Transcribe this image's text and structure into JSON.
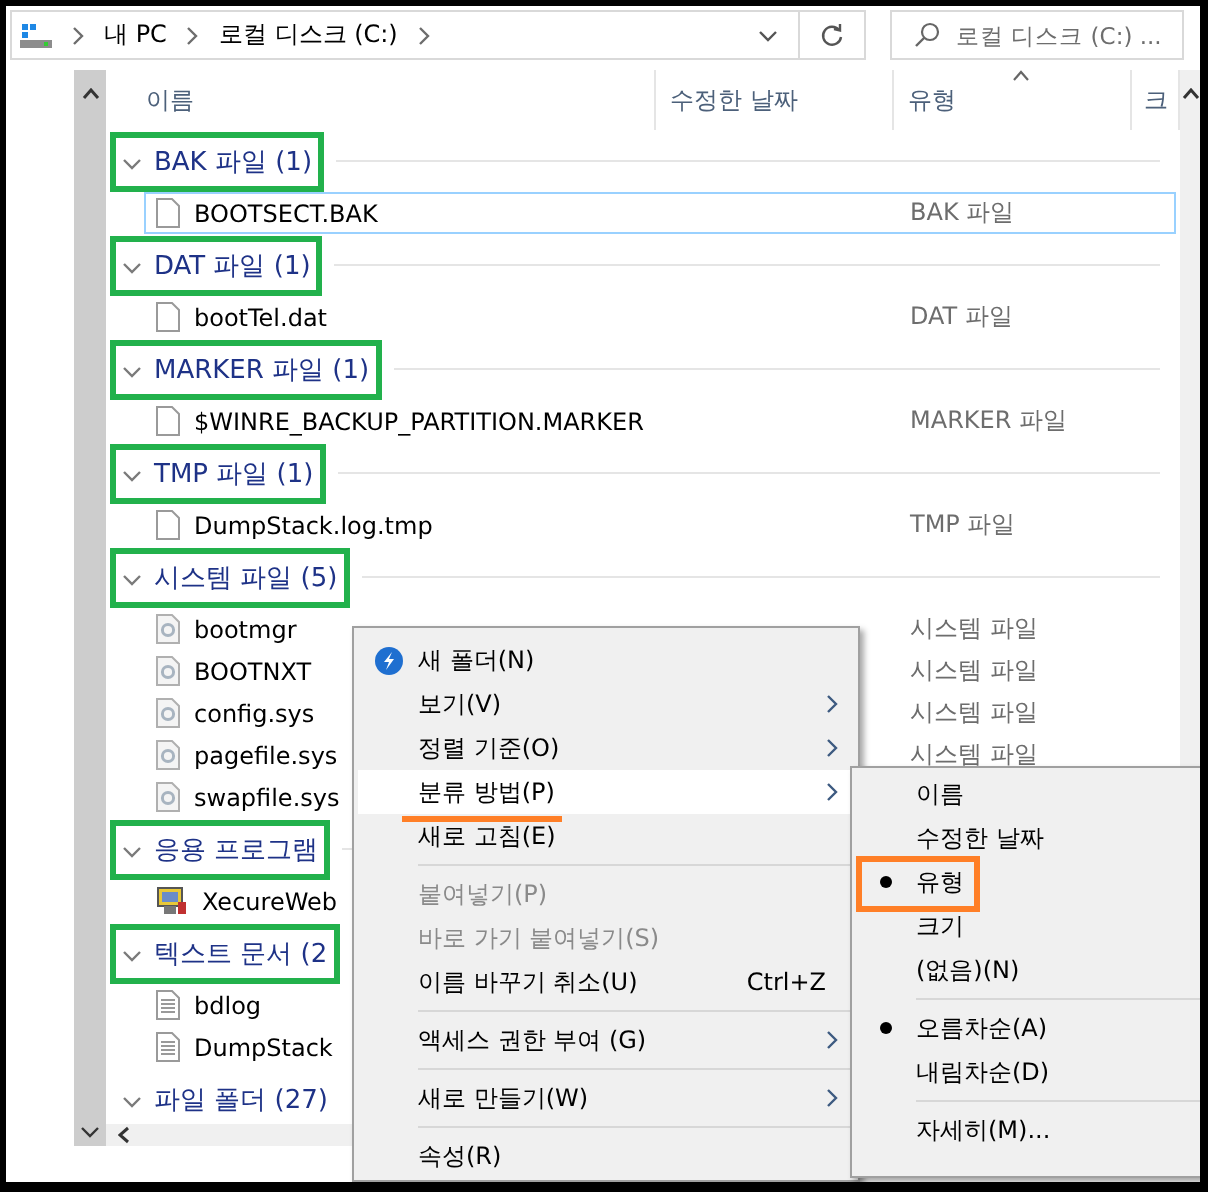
{
  "address_bar": {
    "crumbs": [
      "내 PC",
      "로컬 디스크 (C:)"
    ]
  },
  "search": {
    "placeholder": "로컬 디스크 (C:) ..."
  },
  "columns": [
    {
      "label": "이름",
      "sorted": false
    },
    {
      "label": "수정한 날짜",
      "sorted": false
    },
    {
      "label": "유형",
      "sorted": true
    },
    {
      "label": "크",
      "sorted": false
    }
  ],
  "groups": [
    {
      "label": "BAK 파일 (1)",
      "expanded": true,
      "highlighted": true,
      "files": [
        {
          "name": "BOOTSECT.BAK",
          "kind": "file",
          "type": "BAK 파일",
          "focused": true
        }
      ]
    },
    {
      "label": "DAT 파일 (1)",
      "expanded": true,
      "highlighted": true,
      "files": [
        {
          "name": "bootTel.dat",
          "kind": "file",
          "type": "DAT 파일",
          "focused": false
        }
      ]
    },
    {
      "label": "MARKER 파일 (1)",
      "expanded": true,
      "highlighted": true,
      "files": [
        {
          "name": "$WINRE_BACKUP_PARTITION.MARKER",
          "kind": "file",
          "type": "MARKER 파일",
          "focused": false
        }
      ]
    },
    {
      "label": "TMP 파일 (1)",
      "expanded": true,
      "highlighted": true,
      "files": [
        {
          "name": "DumpStack.log.tmp",
          "kind": "file",
          "type": "TMP 파일",
          "focused": false
        }
      ]
    },
    {
      "label": "시스템 파일 (5)",
      "expanded": true,
      "highlighted": true,
      "files": [
        {
          "name": "bootmgr",
          "kind": "system",
          "type": "시스템 파일",
          "focused": false
        },
        {
          "name": "BOOTNXT",
          "kind": "system",
          "type": "시스템 파일",
          "focused": false
        },
        {
          "name": "config.sys",
          "kind": "system",
          "type": "시스템 파일",
          "focused": false
        },
        {
          "name": "pagefile.sys",
          "kind": "system",
          "type": "시스템 파일",
          "focused": false
        },
        {
          "name": "swapfile.sys",
          "kind": "system",
          "focused": false
        }
      ]
    },
    {
      "label": "응용 프로그램",
      "expanded": true,
      "highlighted": true,
      "files": [
        {
          "name": "XecureWeb",
          "kind": "app",
          "focused": false
        }
      ]
    },
    {
      "label": "텍스트 문서 (2",
      "expanded": true,
      "highlighted": true,
      "files": [
        {
          "name": "bdlog",
          "kind": "text",
          "focused": false
        },
        {
          "name": "DumpStack",
          "kind": "text",
          "focused": false
        }
      ]
    },
    {
      "label": "파일 폴더 (27)",
      "expanded": true,
      "highlighted": false
    }
  ],
  "context_menu": {
    "items": [
      {
        "kind": "icon_command",
        "label": "새 폴더(N)",
        "disabled": false,
        "selected": false,
        "underlined": false
      },
      {
        "kind": "submenu",
        "label": "보기(V)",
        "disabled": false,
        "selected": false,
        "underlined": false
      },
      {
        "kind": "submenu",
        "label": "정렬 기준(O)",
        "disabled": false,
        "selected": false,
        "underlined": false
      },
      {
        "kind": "submenu",
        "label": "분류 방법(P)",
        "disabled": false,
        "selected": true,
        "underlined": true
      },
      {
        "kind": "command",
        "label": "새로 고침(E)",
        "disabled": false,
        "selected": false,
        "underlined": false
      },
      {
        "kind": "separator"
      },
      {
        "kind": "command",
        "label": "붙여넣기(P)",
        "disabled": true,
        "selected": false,
        "underlined": false
      },
      {
        "kind": "command",
        "label": "바로 가기 붙여넣기(S)",
        "disabled": true,
        "selected": false,
        "underlined": false
      },
      {
        "kind": "command",
        "label": "이름 바꾸기 취소(U)",
        "shortcut": "Ctrl+Z",
        "disabled": false,
        "selected": false,
        "underlined": false
      },
      {
        "kind": "separator"
      },
      {
        "kind": "submenu",
        "label": "액세스 권한 부여 (G)",
        "disabled": false,
        "selected": false,
        "underlined": false
      },
      {
        "kind": "separator"
      },
      {
        "kind": "submenu",
        "label": "새로 만들기(W)",
        "disabled": false,
        "selected": false,
        "underlined": false
      },
      {
        "kind": "separator"
      },
      {
        "kind": "command",
        "label": "속성(R)",
        "disabled": false,
        "selected": false,
        "underlined": false
      }
    ]
  },
  "submenu": {
    "items": [
      {
        "kind": "item",
        "label": "이름",
        "checked": false,
        "highlighted": false
      },
      {
        "kind": "item",
        "label": "수정한 날짜",
        "checked": false,
        "highlighted": false
      },
      {
        "kind": "item",
        "label": "유형",
        "checked": true,
        "highlighted": true
      },
      {
        "kind": "item",
        "label": "크기",
        "checked": false,
        "highlighted": false
      },
      {
        "kind": "item",
        "label": "(없음)(N)",
        "checked": false,
        "highlighted": false
      },
      {
        "kind": "separator"
      },
      {
        "kind": "item",
        "label": "오름차순(A)",
        "checked": true,
        "highlighted": false
      },
      {
        "kind": "item",
        "label": "내림차순(D)",
        "checked": false,
        "highlighted": false
      },
      {
        "kind": "separator"
      },
      {
        "kind": "item",
        "label": "자세히(M)...",
        "checked": false,
        "highlighted": false
      }
    ]
  }
}
